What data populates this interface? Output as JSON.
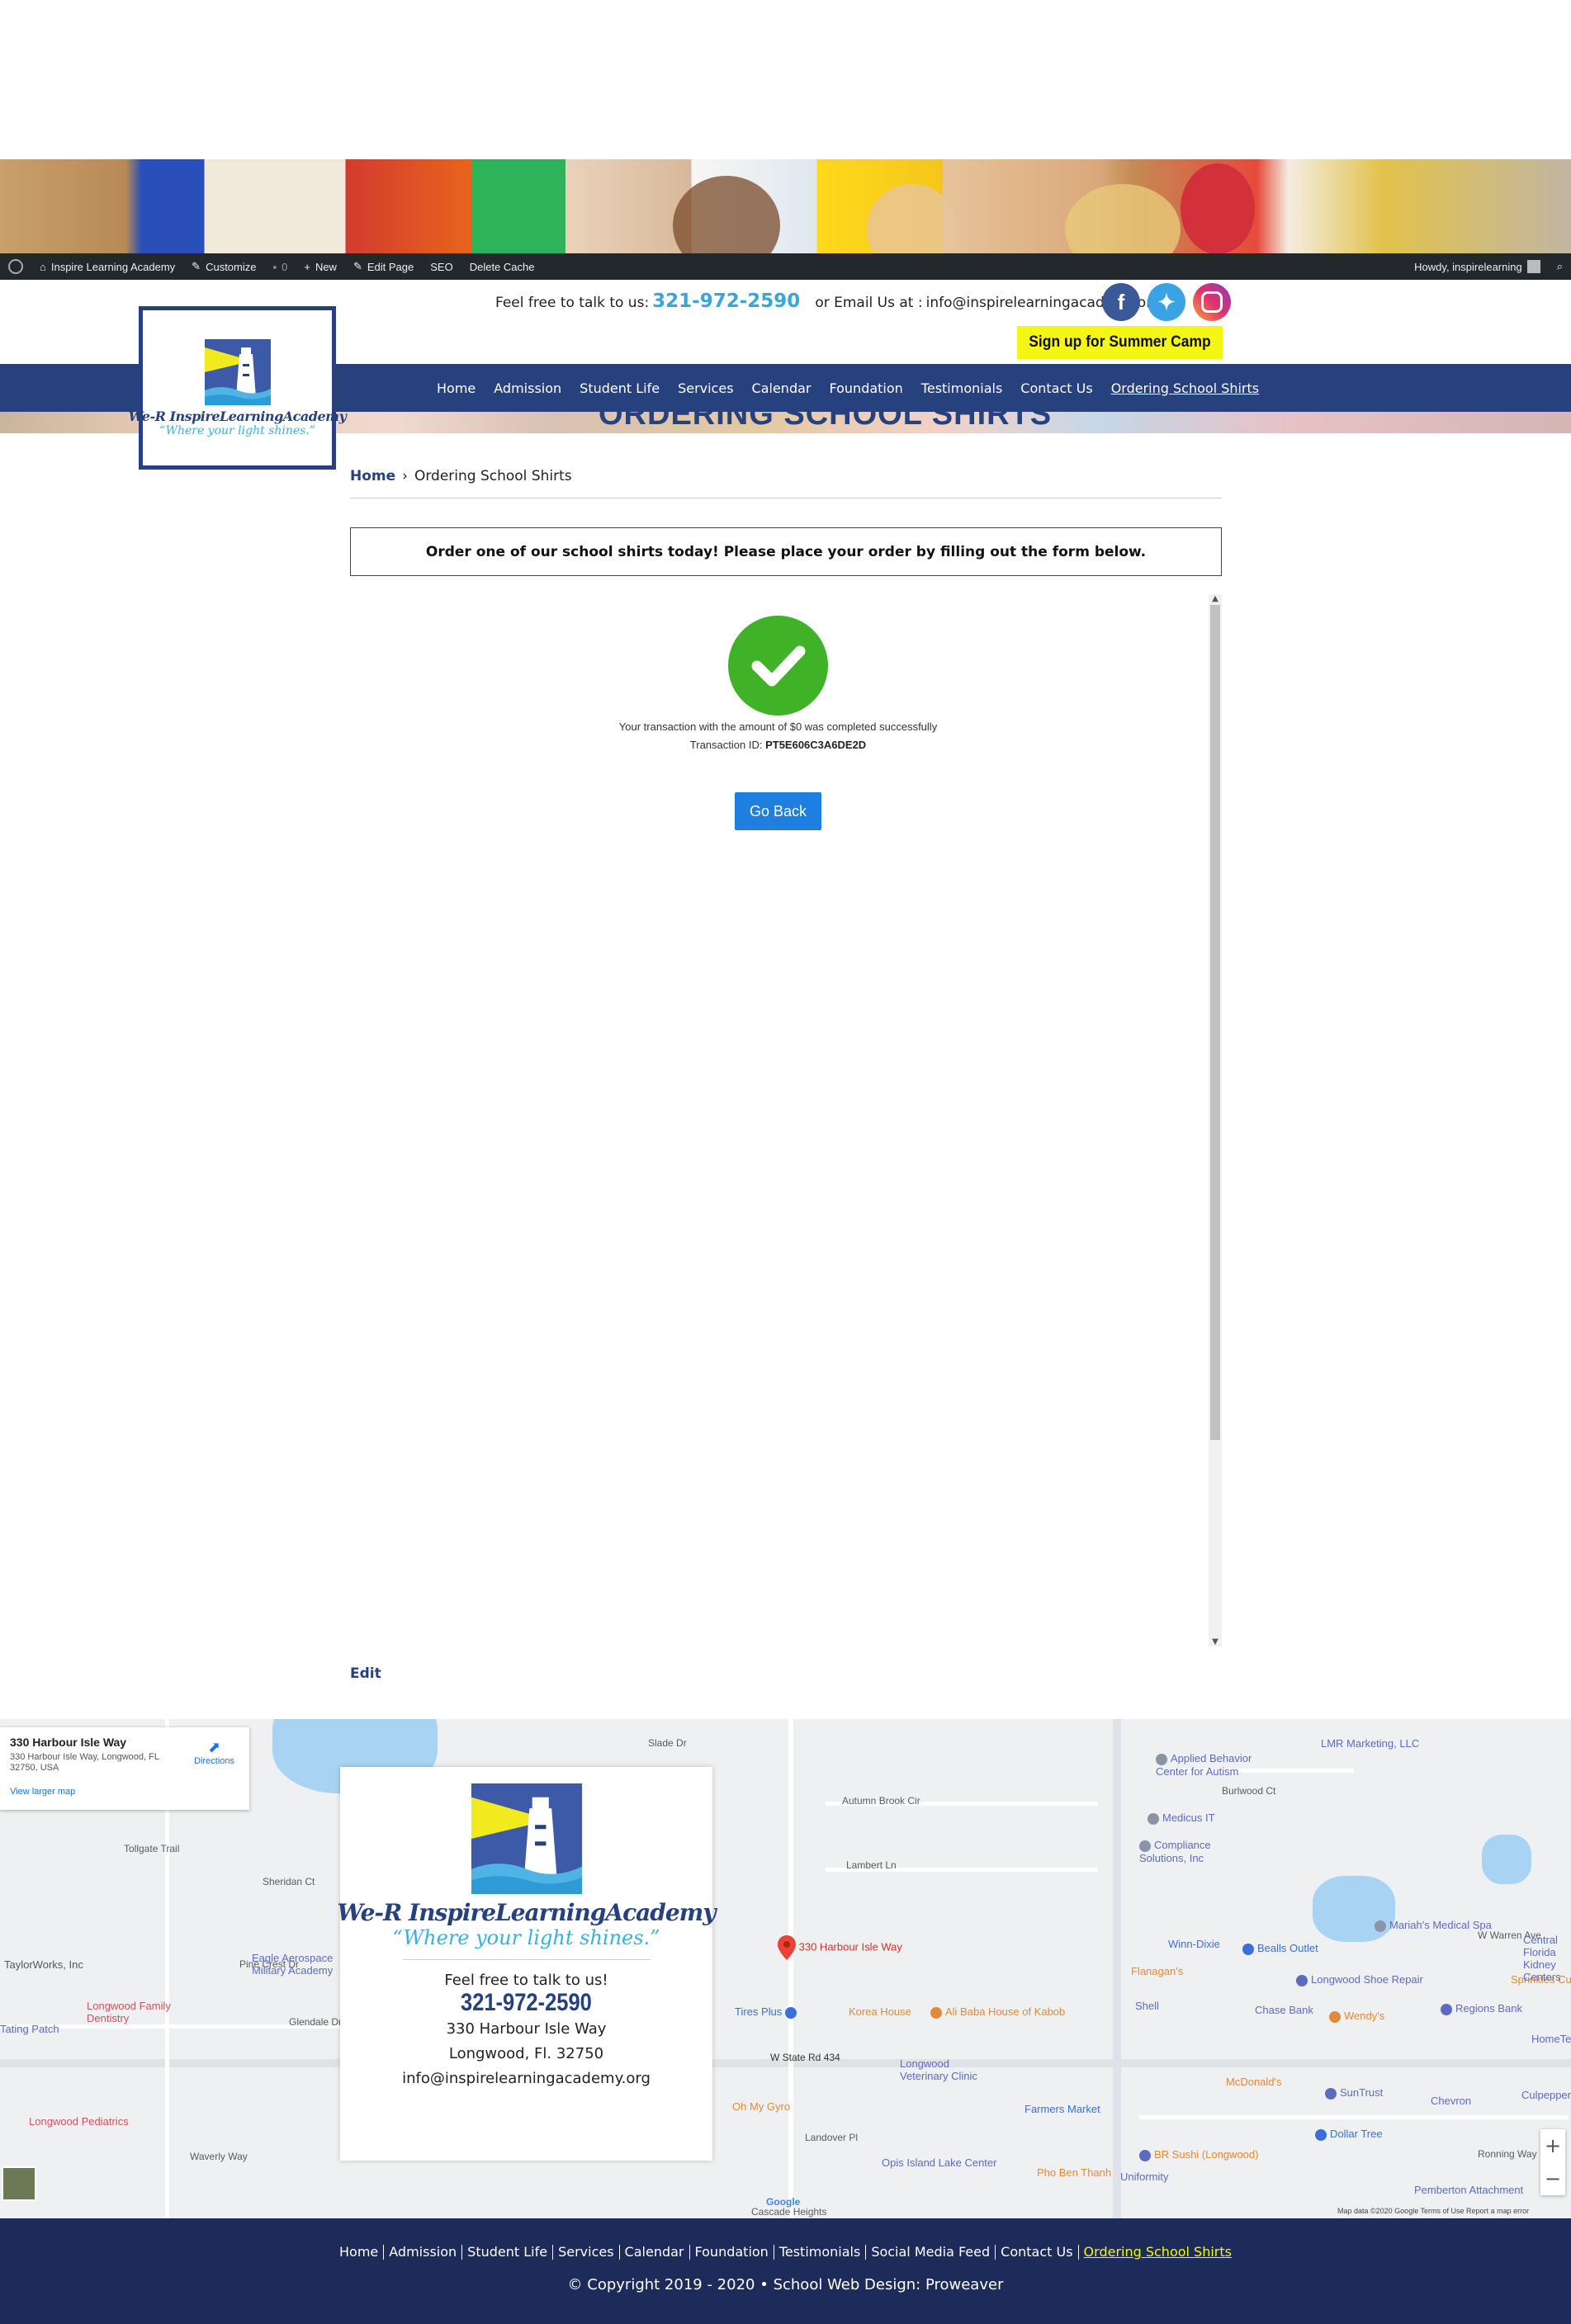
{
  "admin_bar": {
    "site_name": "Inspire Learning Academy",
    "customize": "Customize",
    "comments_count": "0",
    "new": "New",
    "edit_page": "Edit Page",
    "seo": "SEO",
    "delete_cache": "Delete Cache",
    "howdy": "Howdy, inspirelearning"
  },
  "header": {
    "logo_title": "We-R InspireLearningAcademy",
    "logo_tagline": "“Where your light shines.”",
    "contact_prefix": "Feel free to talk to us:",
    "phone": "321-972-2590",
    "email_prefix": "or Email Us at :",
    "email": "info@inspirelearningacademy.org",
    "social_icons": [
      "facebook-icon",
      "twitter-icon",
      "instagram-icon"
    ],
    "summer_camp_button": "Sign up for Summer Camp"
  },
  "nav": {
    "items": [
      "Home",
      "Admission",
      "Student Life",
      "Services",
      "Calendar",
      "Foundation",
      "Testimonials",
      "Contact Us",
      "Ordering School Shirts"
    ],
    "current": "Ordering School Shirts"
  },
  "page_heading": "ORDERING SCHOOL SHIRTS",
  "breadcrumb": {
    "home": "Home",
    "separator": "›",
    "current": "Ordering School Shirts"
  },
  "notice": "Order one of our school shirts today! Please place your order by filling out the form below.",
  "transaction": {
    "message": "Your transaction with the amount of $0 was completed successfully",
    "id_label": "Transaction ID:",
    "id_value": "PT5E606C3A6DE2D",
    "button": "Go Back"
  },
  "edit_link": "Edit",
  "map": {
    "place_title": "330 Harbour Isle Way",
    "place_address": "330 Harbour Isle Way, Longwood, FL 32750, USA",
    "directions": "Directions",
    "view_larger": "View larger map",
    "marker_label": "330 Harbour Isle Way",
    "labels": [
      "Slade Dr",
      "Autumn Brook Cir",
      "Lambert Ln",
      "W State Rd 434",
      "Landover Pl",
      "Waverly Way",
      "Glendale Dr",
      "Sheridan Ct",
      "Pine Crest Dr",
      "Tollgate Trail",
      "Burlwood Ct",
      "W Warren Ave",
      "Ronning Way",
      "Cascade Heights"
    ],
    "pois": [
      "Applied Behavior Center for Autism",
      "LMR Marketing, LLC",
      "Medicus IT",
      "Compliance Solutions, Inc",
      "Mariah's Medical Spa",
      "Winn-Dixie",
      "Bealls Outlet",
      "Flanagan's",
      "Longwood Shoe Repair",
      "Sprinkles Custom Cakes",
      "Central Florida Kidney Centers",
      "Shell",
      "Chase Bank",
      "Wendy's",
      "Regions Bank",
      "Tires Plus",
      "Korea House",
      "Ali Baba House of Kabob",
      "Longwood Veterinary Clinic",
      "McDonald's",
      "SunTrust",
      "Chevron",
      "Culpepper",
      "Oh My Gyro",
      "Farmers Market",
      "Dollar Tree",
      "Opis Island Lake Center",
      "Pho Ben Thanh",
      "BR Sushi (Longwood)",
      "Uniformity",
      "Pemberton Attachment",
      "Eagle Aerospace Military Academy",
      "TaylorWorks, Inc",
      "Longwood Family Dentistry",
      "Longwood Pediatrics",
      "Tating Patch",
      "HomeTeam"
    ],
    "footer_note": "Map data ©2020 Google   Terms of Use   Report a map error",
    "google": "Google"
  },
  "info_card": {
    "logo_title": "We-R InspireLearningAcademy",
    "tagline": "“Where your light shines.”",
    "talk": "Feel free to talk to us!",
    "phone": "321-972-2590",
    "address1": "330 Harbour Isle Way",
    "address2": "Longwood, Fl. 32750",
    "email": "info@inspirelearningacademy.org"
  },
  "footer": {
    "links": [
      "Home",
      "Admission",
      "Student Life",
      "Services",
      "Calendar",
      "Foundation",
      "Testimonials",
      "Social Media Feed",
      "Contact Us",
      "Ordering School Shirts"
    ],
    "current": "Ordering School Shirts",
    "copyright": "© Copyright 2019 - 2020",
    "bullet": "•",
    "design": "School Web Design: Proweaver"
  },
  "colors": {
    "brand_navy": "#27417e",
    "footer_navy": "#1c2b5a",
    "accent_blue": "#39a5d9",
    "summer_yellow": "#f4f713",
    "success_green": "#3fb227",
    "button_blue": "#1f7fe0"
  }
}
